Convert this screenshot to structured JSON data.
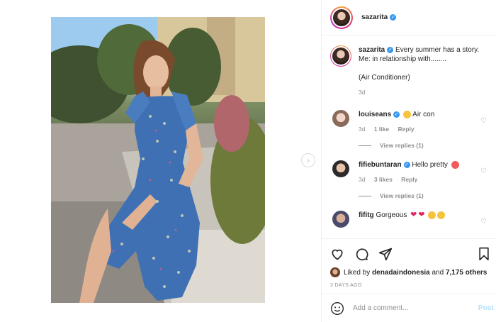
{
  "post": {
    "username": "sazarita",
    "caption_line1": "Every summer has a story.",
    "caption_line2": "Me: in relationship with........",
    "caption_line3": "(Air Conditioner)",
    "caption_age": "3d"
  },
  "comments": [
    {
      "username": "louiseans",
      "text": "Air con",
      "age": "3d",
      "likes": "1 like",
      "reply": "Reply",
      "view_replies": "View replies (1)"
    },
    {
      "username": "fifiebuntaran",
      "text": "Hello pretty",
      "age": "3d",
      "likes": "3 likes",
      "reply": "Reply",
      "view_replies": "View replies (1)"
    },
    {
      "username": "fifitg",
      "text": "Gorgeous"
    }
  ],
  "likes": {
    "prefix": "Liked by",
    "user": "denadaindonesia",
    "and": "and",
    "count": "7,175 others"
  },
  "timestamp": "3 DAYS AGO",
  "add_comment": {
    "placeholder": "Add a comment...",
    "post_label": "Post"
  },
  "icons": {
    "next": "chevron-right-icon",
    "verified": "verified-badge-icon",
    "like": "heart-icon",
    "comment": "comment-icon",
    "share": "paper-plane-icon",
    "save": "bookmark-icon",
    "emoji": "smiley-icon"
  },
  "colors": {
    "link": "#3897f0",
    "post_disabled": "#b2dffc",
    "muted": "#8e8e8e",
    "text": "#262626"
  }
}
